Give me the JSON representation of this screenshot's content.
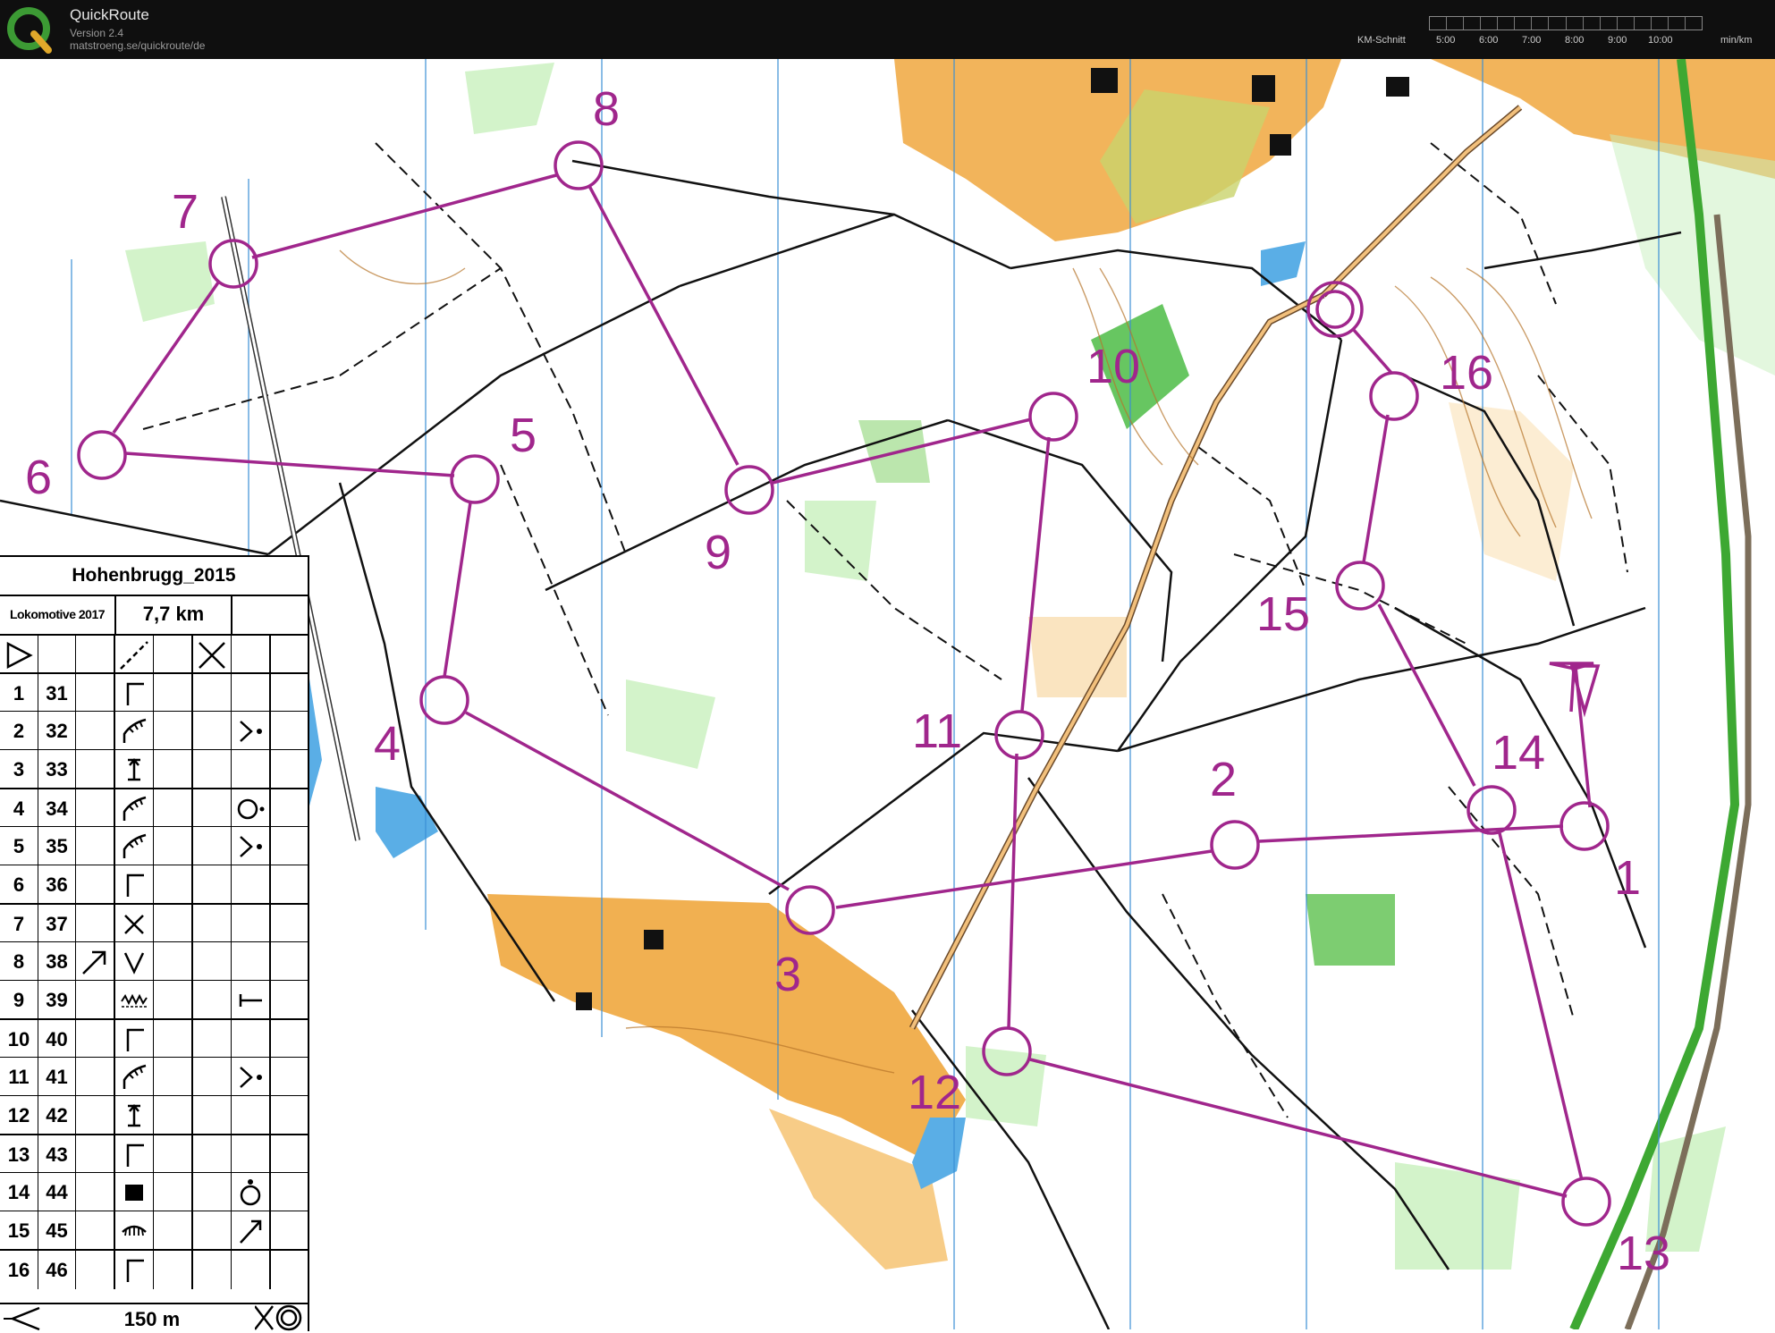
{
  "app": {
    "title": "QuickRoute",
    "version": "Version 2.4",
    "url": "matstroeng.se/quickroute/de"
  },
  "pace_scale": {
    "label": "KM-Schnitt",
    "ticks": [
      "5:00",
      "6:00",
      "7:00",
      "8:00",
      "9:00",
      "10:00"
    ],
    "unit": "min/km"
  },
  "course": {
    "color": "#a0268c",
    "controls": [
      {
        "number": "1"
      },
      {
        "number": "2"
      },
      {
        "number": "3"
      },
      {
        "number": "4"
      },
      {
        "number": "5"
      },
      {
        "number": "6"
      },
      {
        "number": "7"
      },
      {
        "number": "8"
      },
      {
        "number": "9"
      },
      {
        "number": "10"
      },
      {
        "number": "11"
      },
      {
        "number": "12"
      },
      {
        "number": "13"
      },
      {
        "number": "14"
      },
      {
        "number": "15"
      },
      {
        "number": "16"
      }
    ]
  },
  "legend": {
    "title": "Hohenbrugg_2015",
    "club": "Lokomotive 2017",
    "distance": "7,7 km",
    "rows": [
      {
        "seq": "1",
        "code": "31",
        "feature": "Γ-corner-icon"
      },
      {
        "seq": "2",
        "code": "32",
        "feature": "cliff-icon",
        "location": "junction-icon"
      },
      {
        "seq": "3",
        "code": "33",
        "feature": "post-icon"
      },
      {
        "seq": "4",
        "code": "34",
        "feature": "cliff-icon",
        "location": "circle-dot-icon"
      },
      {
        "seq": "5",
        "code": "35",
        "feature": "cliff-icon",
        "location": "junction-icon"
      },
      {
        "seq": "6",
        "code": "36",
        "feature": "Γ-corner-icon"
      },
      {
        "seq": "7",
        "code": "37",
        "feature": "cross-icon"
      },
      {
        "seq": "8",
        "code": "38",
        "feature": "v-depression-icon",
        "direction": "arrow-ne-icon"
      },
      {
        "seq": "9",
        "code": "39",
        "feature": "wall-icon",
        "location": "end-icon"
      },
      {
        "seq": "10",
        "code": "40",
        "feature": "Γ-corner-icon"
      },
      {
        "seq": "11",
        "code": "41",
        "feature": "cliff-icon",
        "location": "junction-icon"
      },
      {
        "seq": "12",
        "code": "42",
        "feature": "post-icon"
      },
      {
        "seq": "13",
        "code": "43",
        "feature": "Γ-corner-icon"
      },
      {
        "seq": "14",
        "code": "44",
        "feature": "building-icon",
        "location": "dot-top-icon"
      },
      {
        "seq": "15",
        "code": "45",
        "feature": "eye-icon",
        "location": "corner-icon"
      },
      {
        "seq": "16",
        "code": "46",
        "feature": "Γ-corner-icon"
      }
    ],
    "scale_text": "150 m"
  }
}
